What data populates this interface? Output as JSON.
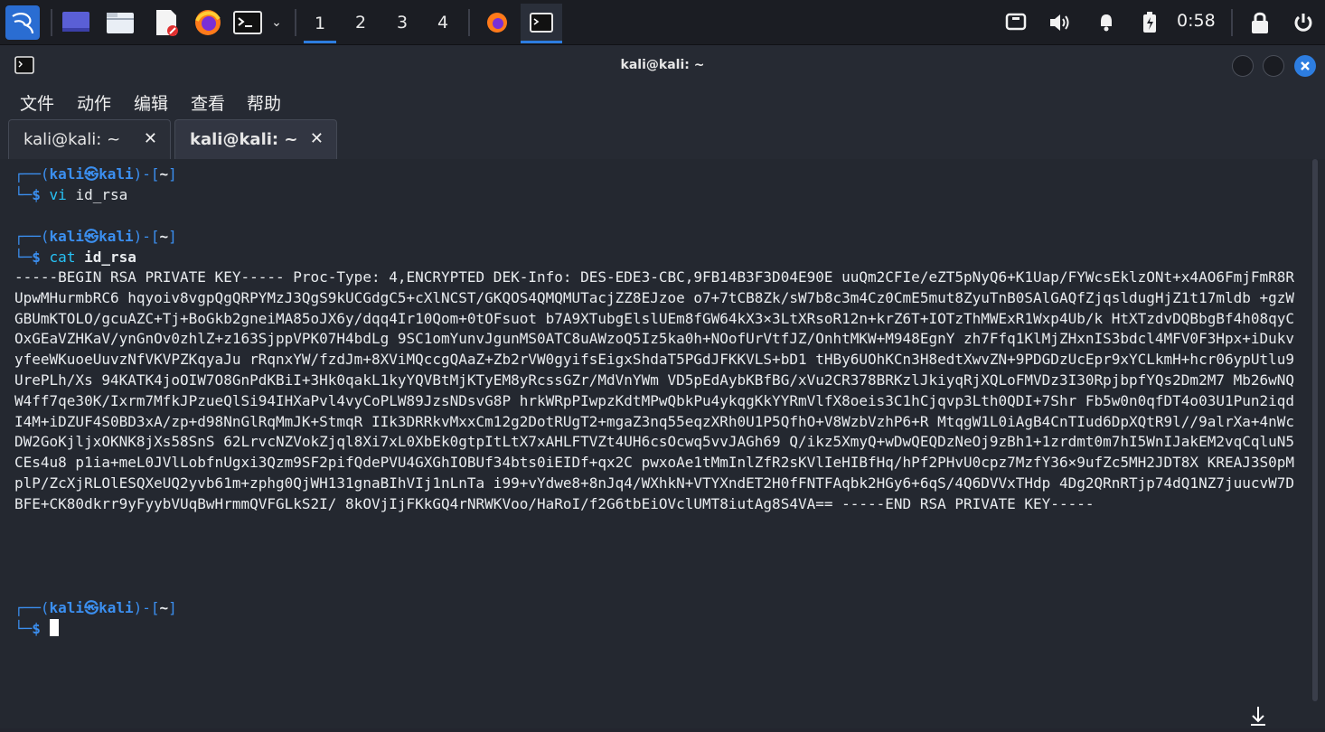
{
  "taskbar": {
    "workspaces": [
      "1",
      "2",
      "3",
      "4"
    ],
    "active_workspace": "1",
    "clock": "0:58",
    "icons": [
      "kali-menu-icon",
      "desktop-icon",
      "file-manager-icon",
      "text-editor-icon",
      "firefox-icon",
      "terminal-icon",
      "dropdown-icon",
      "firefox-running-icon",
      "terminal-running-icon",
      "screen-icon",
      "volume-icon",
      "notifications-icon",
      "battery-icon",
      "lock-icon",
      "power-icon"
    ]
  },
  "window": {
    "title": "kali@kali: ~",
    "menu": [
      "文件",
      "动作",
      "编辑",
      "查看",
      "帮助"
    ],
    "tabs": [
      {
        "label": "kali@kali: ~",
        "close": "✕"
      },
      {
        "label": "kali@kali: ~",
        "close": "✕"
      }
    ]
  },
  "terminal": {
    "prompt_prefix": "┌──(",
    "prompt_user": "kali㉿kali",
    "prompt_suffix": ")-[",
    "prompt_dir": "~",
    "prompt_close": "]",
    "prompt_line2": "└─",
    "prompt_symbol": "$",
    "cmd1_name": "vi",
    "cmd1_arg": " id_rsa",
    "cmd2_name": "cat",
    "cmd2_arg": "id_rsa",
    "output": "-----BEGIN RSA PRIVATE KEY----- Proc-Type: 4,ENCRYPTED DEK-Info: DES-EDE3-CBC,9FB14B3F3D04E90E uuQm2CFIe/eZT5pNyQ6+K1Uap/FYWcsEklzONt+x4AO6FmjFmR8RUpwMHurmbRC6 hqyoiv8vgpQgQRPYMzJ3QgS9kUCGdgC5+cXlNCST/GKQOS4QMQMUTacjZZ8EJzoe o7+7tCB8Zk/sW7b8c3m4Cz0CmE5mut8ZyuTnB0SAlGAQfZjqsldugHjZ1t17mldb +gzWGBUmKTOLO/gcuAZC+Tj+BoGkb2gneiMA85oJX6y/dqq4Ir10Qom+0tOFsuot b7A9XTubgElslUEm8fGW64kX3×3LtXRsoR12n+krZ6T+IOTzThMWExR1Wxp4Ub/k HtXTzdvDQBbgBf4h08qyCOxGEaVZHKaV/ynGnOv0zhlZ+z163SjppVPK07H4bdLg 9SC1omYunvJgunMS0ATC8uAWzoQ5Iz5ka0h+NOofUrVtfJZ/OnhtMKW+M948EgnY zh7Ffq1KlMjZHxnIS3bdcl4MFV0F3Hpx+iDukvyfeeWKuoeUuvzNfVKVPZKqyaJu rRqnxYW/fzdJm+8XViMQccgQAaZ+Zb2rVW0gyifsEigxShdaT5PGdJFKKVLS+bD1 tHBy6UOhKCn3H8edtXwvZN+9PDGDzUcEpr9xYCLkmH+hcr06ypUtlu9UrePLh/Xs 94KATK4joOIW7O8GnPdKBiI+3Hk0qakL1kyYQVBtMjKTyEM8yRcssGZr/MdVnYWm VD5pEdAybKBfBG/xVu2CR378BRKzlJkiyqRjXQLoFMVDz3I30RpjbpfYQs2Dm2M7 Mb26wNQW4ff7qe30K/Ixrm7MfkJPzueQlSi94IHXaPvl4vyCoPLW89JzsNDsvG8P hrkWRpPIwpzKdtMPwQbkPu4ykqgKkYYRmVlfX8oeis3C1hCjqvp3Lth0QDI+7Shr Fb5w0n0qfDT4o03U1Pun2iqdI4M+iDZUF4S0BD3xA/zp+d98NnGlRqMmJK+StmqR IIk3DRRkvMxxCm12g2DotRUgT2+mgaZ3nq55eqzXRh0U1P5QfhO+V8WzbVzhP6+R MtqgW1L0iAgB4CnTIud6DpXQtR9l//9alrXa+4nWcDW2GoKjljxOKNK8jXs58SnS 62LrvcNZVokZjql8Xi7xL0XbEk0gtpItLtX7xAHLFTVZt4UH6csOcwq5vvJAGh69 Q/ikz5XmyQ+wDwQEQDzNeOj9zBh1+1zrdmt0m7hI5WnIJakEM2vqCqluN5CEs4u8 p1ia+meL0JVlLobfnUgxi3Qzm9SF2pifQdePVU4GXGhIOBUf34bts0iEIDf+qx2C pwxoAe1tMmInlZfR2sKVlIeHIBfHq/hPf2PHvU0cpz7MzfY36×9ufZc5MH2JDT8X KREAJ3S0pMplP/ZcXjRLOlESQXeUQ2yvb61m+zphg0QjWH131gnaBIhVIj1nLnTa i99+vYdwe8+8nJq4/WXhkN+VTYXndET2H0fFNTFAqbk2HGy6+6qS/4Q6DVVxTHdp 4Dg2QRnRTjp74dQ1NZ7juucvW7DBFE+CK80dkrr9yFyybVUqBwHrmmQVFGLkS2I/ 8kOVjIjFKkGQ4rNRWKVoo/HaRoI/f2G6tbEiOVclUMT8iutAg8S4VA== -----END RSA PRIVATE KEY-----"
  }
}
